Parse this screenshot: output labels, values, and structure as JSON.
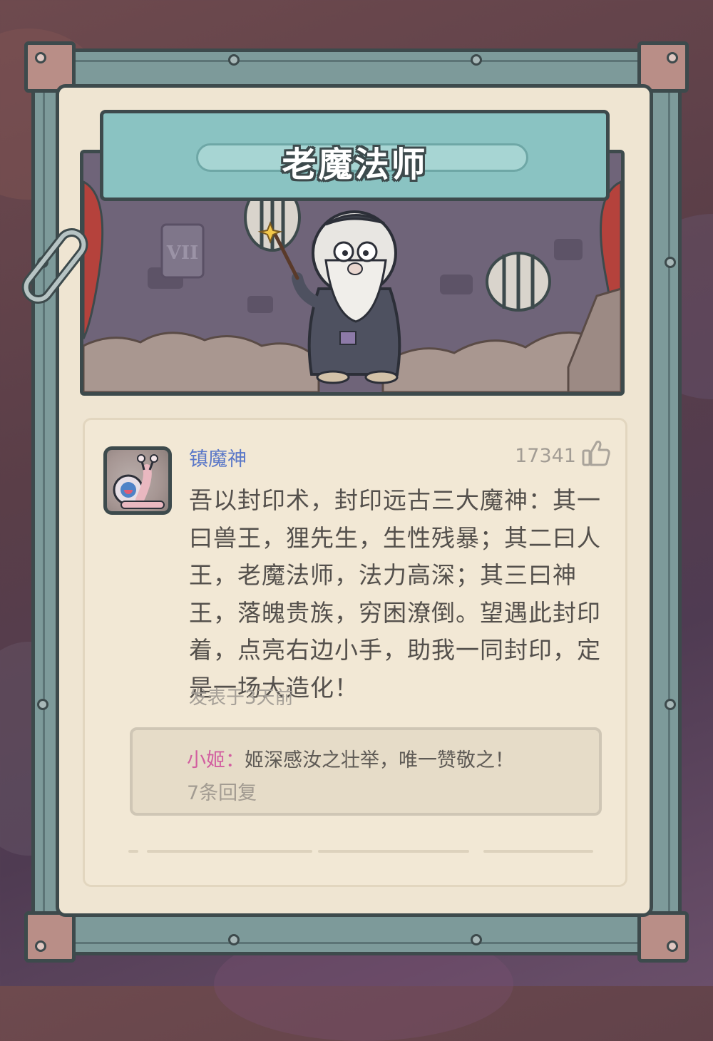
{
  "scene": {
    "title": "老魔法师",
    "plaque": "VII"
  },
  "comment": {
    "username": "镇魔神",
    "likes": "17341",
    "text": "吾以封印术，封印远古三大魔神：其一曰兽王，狸先生，生性残暴；其二曰人王，老魔法师，法力高深；其三曰神王，落魄贵族，穷困潦倒。望遇此封印着，点亮右边小手，助我一同封印，定是一场大造化！",
    "posted": "发表于3天前"
  },
  "reply": {
    "user": "小姬：",
    "text": "姬深感汝之壮举，唯一赞敬之！",
    "count": "7条回复"
  },
  "icons": {
    "like": "thumbs-up-icon",
    "avatar": "snail-avatar",
    "clip": "paperclip-icon"
  },
  "colors": {
    "username": "#5b78c8",
    "reply_user": "#d25ea0",
    "banner": "#8ac3c2",
    "frame": "#7d9a9a",
    "parchment": "#efe5d2"
  }
}
